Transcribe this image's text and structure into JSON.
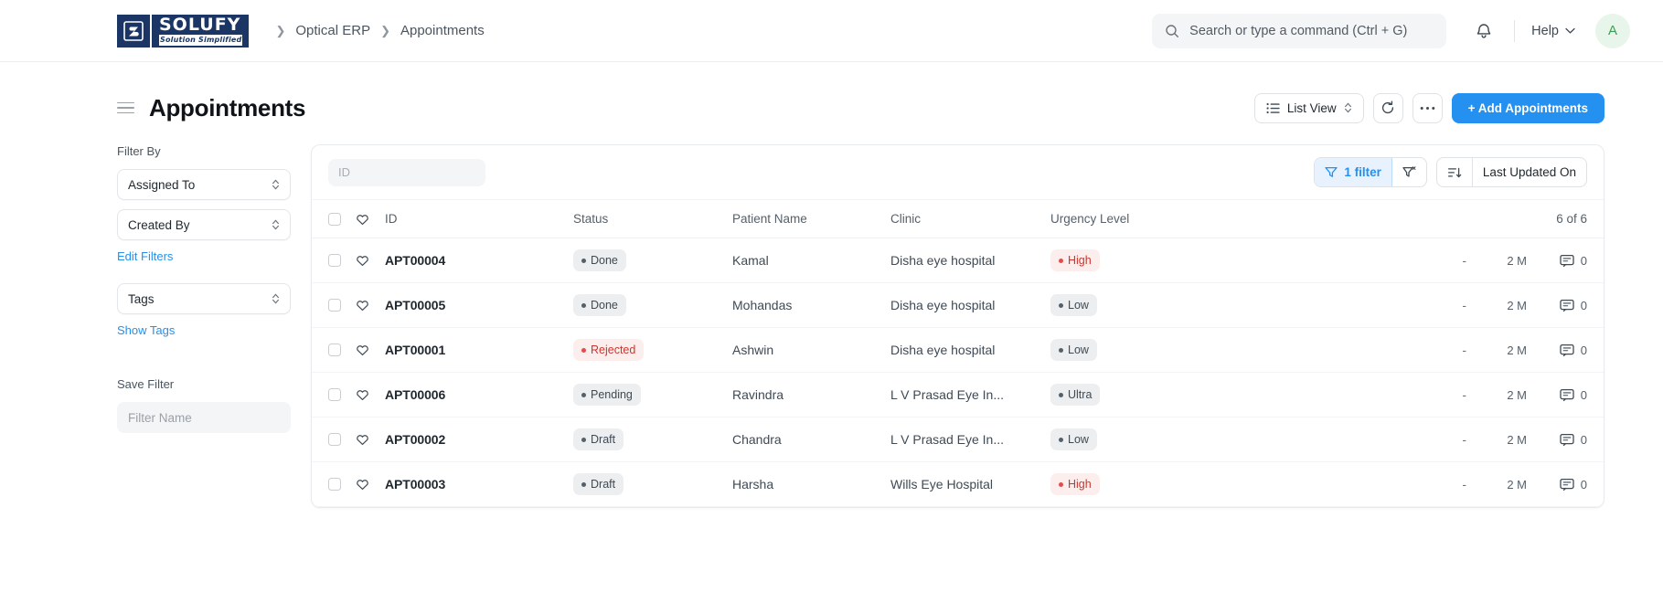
{
  "navbar": {
    "logo": {
      "mark": "S",
      "word_top": "SOLUFY",
      "word_bottom": "Solution Simplified"
    },
    "breadcrumb": [
      "Optical ERP",
      "Appointments"
    ],
    "search": {
      "placeholder": "Search or type a command (Ctrl + G)",
      "value": ""
    },
    "help_label": "Help",
    "avatar_initial": "A"
  },
  "page": {
    "title": "Appointments",
    "actions": {
      "view_label": "List View",
      "add_label": "+ Add Appointments"
    }
  },
  "sidebar": {
    "filter_by_label": "Filter By",
    "filters": [
      {
        "label": "Assigned To"
      },
      {
        "label": "Created By"
      }
    ],
    "edit_filters_label": "Edit Filters",
    "tags": {
      "label": "Tags"
    },
    "show_tags_label": "Show Tags",
    "save_filter_label": "Save Filter",
    "filter_name_placeholder": "Filter Name",
    "filter_name_value": ""
  },
  "list": {
    "id_filter_placeholder": "ID",
    "id_filter_value": "",
    "filter_count_label": "1 filter",
    "sort_label": "Last Updated On",
    "count_label": "6 of 6",
    "columns": [
      "ID",
      "Status",
      "Patient Name",
      "Clinic",
      "Urgency Level"
    ],
    "rows": [
      {
        "id": "APT00004",
        "status": "Done",
        "status_tone": "grey",
        "patient": "Kamal",
        "clinic": "Disha eye hospital",
        "urgency": "High",
        "urgency_tone": "red",
        "dash": "-",
        "modified": "2 M",
        "comments": "0"
      },
      {
        "id": "APT00005",
        "status": "Done",
        "status_tone": "grey",
        "patient": "Mohandas",
        "clinic": "Disha eye hospital",
        "urgency": "Low",
        "urgency_tone": "grey",
        "dash": "-",
        "modified": "2 M",
        "comments": "0"
      },
      {
        "id": "APT00001",
        "status": "Rejected",
        "status_tone": "red",
        "patient": "Ashwin",
        "clinic": "Disha eye hospital",
        "urgency": "Low",
        "urgency_tone": "grey",
        "dash": "-",
        "modified": "2 M",
        "comments": "0"
      },
      {
        "id": "APT00006",
        "status": "Pending",
        "status_tone": "grey",
        "patient": "Ravindra",
        "clinic": "L V Prasad Eye In...",
        "urgency": "Ultra",
        "urgency_tone": "grey",
        "dash": "-",
        "modified": "2 M",
        "comments": "0"
      },
      {
        "id": "APT00002",
        "status": "Draft",
        "status_tone": "grey",
        "patient": "Chandra",
        "clinic": "L V Prasad Eye In...",
        "urgency": "Low",
        "urgency_tone": "grey",
        "dash": "-",
        "modified": "2 M",
        "comments": "0"
      },
      {
        "id": "APT00003",
        "status": "Draft",
        "status_tone": "grey",
        "patient": "Harsha",
        "clinic": "Wills Eye Hospital",
        "urgency": "High",
        "urgency_tone": "red",
        "dash": "-",
        "modified": "2 M",
        "comments": "0"
      }
    ]
  },
  "colors": {
    "brand_navy": "#1b3664",
    "primary_blue": "#2490ef",
    "filter_active_bg": "#e8f2fe",
    "status_red": "#c8372d",
    "avatar_green": "#3e9e52"
  }
}
